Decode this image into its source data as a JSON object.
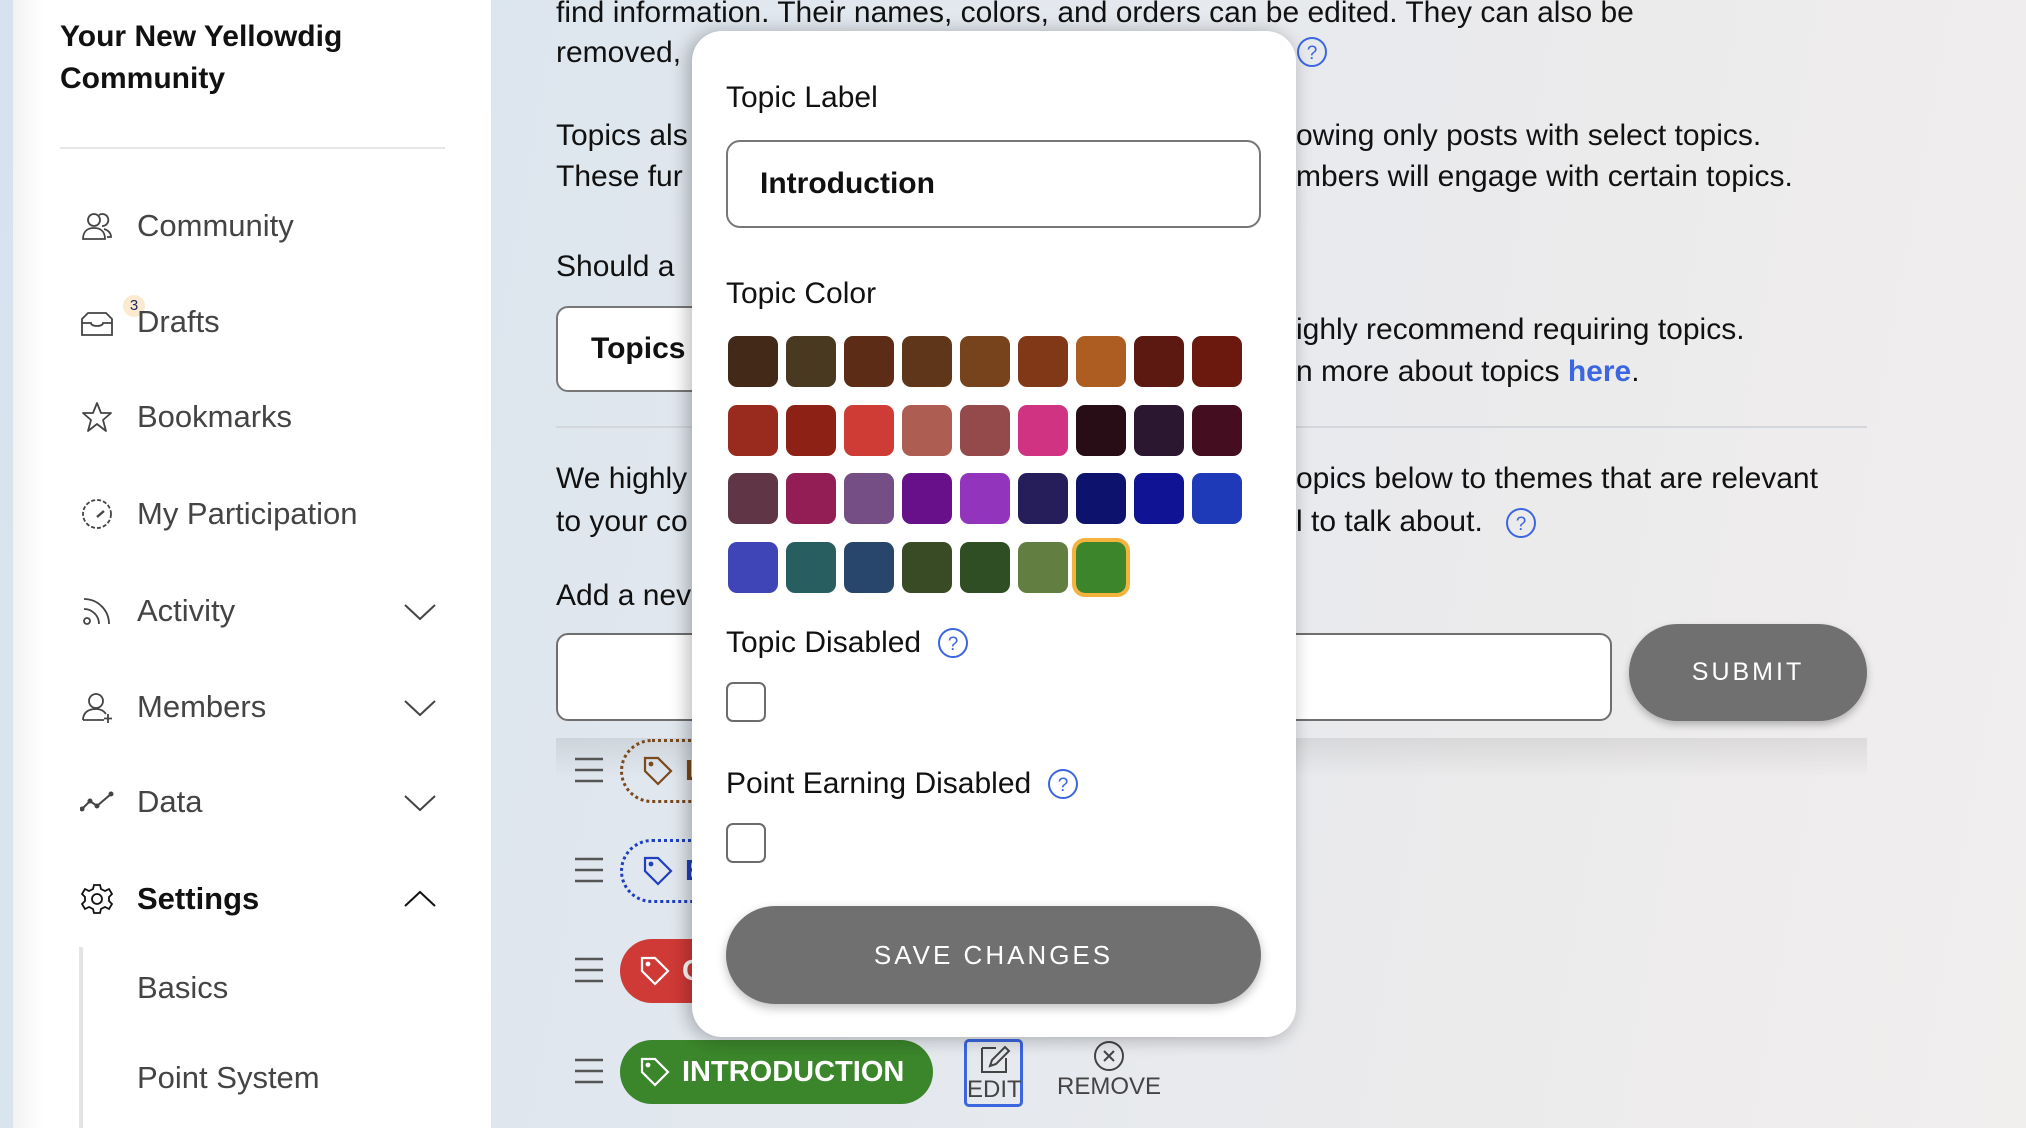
{
  "sidebar": {
    "community_title": "Your New Yellowdig Community",
    "items": [
      {
        "label": "Community",
        "icon": "community-icon"
      },
      {
        "label": "Drafts",
        "icon": "inbox-icon",
        "badge": "3"
      },
      {
        "label": "Bookmarks",
        "icon": "star-icon"
      },
      {
        "label": "My Participation",
        "icon": "gauge-icon"
      },
      {
        "label": "Activity",
        "icon": "rss-icon",
        "expandable": true,
        "expanded": false
      },
      {
        "label": "Members",
        "icon": "add-user-icon",
        "expandable": true,
        "expanded": false
      },
      {
        "label": "Data",
        "icon": "line-chart-icon",
        "expandable": true,
        "expanded": false
      },
      {
        "label": "Settings",
        "icon": "gear-icon",
        "expandable": true,
        "expanded": true,
        "active": true
      }
    ],
    "sub_items": [
      {
        "label": "Basics"
      },
      {
        "label": "Point System"
      }
    ]
  },
  "main": {
    "intro_line1": "find information. Their names, colors, and orders can be edited. They can also be",
    "intro_line2_left": "removed,",
    "filter_line1_left": "Topics als",
    "filter_line1_right": "owing only posts with select topics.",
    "filter_line2_left": "These fur",
    "filter_line2_right": "mbers will engage with certain topics.",
    "require_question_left": "Should a",
    "require_select_value": "Topics",
    "recommend_line1_right": "ighly recommend requiring topics.",
    "recommend_line2_right": "n more about topics ",
    "recommend_link": "here",
    "recommend_period": ".",
    "theme_line1_left": "We highly",
    "theme_line1_right": "opics below to themes that are relevant",
    "theme_line2_left": "to your co",
    "theme_line2_right": "l to talk about.",
    "add_new_label_left": "Add a nev",
    "new_topic_input_value": "",
    "submit_label": "SUBMIT",
    "topics": [
      {
        "label": "L",
        "color": "#7a4a1c",
        "style": "dotted"
      },
      {
        "label": "E",
        "color": "#1f3fbf",
        "style": "dotted"
      },
      {
        "label": "C",
        "color": "#d03a36",
        "style": "filled"
      },
      {
        "label": "INTRODUCTION",
        "color": "#3b852b",
        "style": "filled"
      }
    ],
    "edit_label": "EDIT",
    "remove_label": "REMOVE"
  },
  "modal": {
    "topic_label_heading": "Topic Label",
    "topic_label_value": "Introduction",
    "topic_color_heading": "Topic Color",
    "colors": [
      "#432918",
      "#483920",
      "#5d2c16",
      "#60361a",
      "#77431c",
      "#813816",
      "#ae5d22",
      "#5b1911",
      "#6b190f",
      "#982b1e",
      "#8e2115",
      "#cf3c36",
      "#ad5d51",
      "#944a4a",
      "#cf3382",
      "#280c16",
      "#2c1731",
      "#450d20",
      "#603646",
      "#931d55",
      "#744e84",
      "#67108a",
      "#9234bc",
      "#261d5b",
      "#0d136d",
      "#101394",
      "#1e3ab9",
      "#3f45b6",
      "#295e61",
      "#28466b",
      "#394b25",
      "#2f4e24",
      "#627e40",
      "#3c852b"
    ],
    "selected_color": "#3c852b",
    "topic_disabled_label": "Topic Disabled",
    "topic_disabled_checked": false,
    "point_earning_disabled_label": "Point Earning Disabled",
    "point_earning_disabled_checked": false,
    "save_label": "SAVE CHANGES"
  },
  "accent_color": "#3b66e0"
}
